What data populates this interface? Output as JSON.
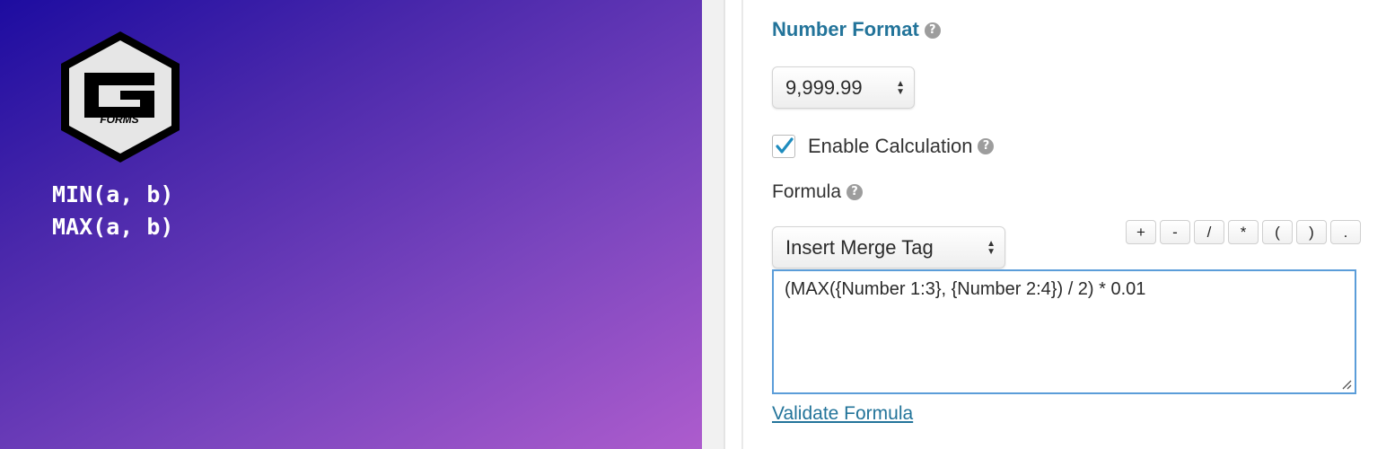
{
  "banner": {
    "logo_text": "FORMS",
    "functions": [
      "MIN(a, b)",
      "MAX(a, b)"
    ]
  },
  "panel": {
    "section_title": "Number Format",
    "number_format": {
      "selected": "9,999.99"
    },
    "enable_calculation": {
      "label": "Enable Calculation",
      "checked": true
    },
    "formula": {
      "label": "Formula",
      "merge_tag_select": "Insert Merge Tag",
      "operators": [
        "+",
        "-",
        "/",
        "*",
        "(",
        ")",
        "."
      ],
      "value": "(MAX({Number 1:3}, {Number 2:4}) / 2) * 0.01"
    },
    "validate_link": "Validate Formula",
    "help_icon": "?"
  },
  "colors": {
    "accent": "#23749a",
    "focus_border": "#5b9dd9",
    "gradient_start": "#1d0ca0",
    "gradient_end": "#ad5ccd"
  },
  "icons": [
    "gravity-forms-logo-icon",
    "help-icon",
    "checkmark-icon",
    "select-arrows-icon",
    "resize-grip-icon"
  ]
}
